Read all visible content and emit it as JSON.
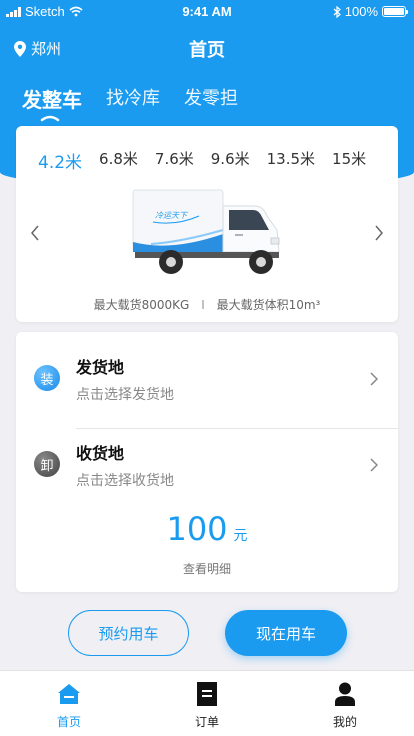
{
  "status_bar": {
    "carrier": "Sketch",
    "time": "9:41 AM",
    "battery": "100%"
  },
  "header": {
    "location": "郑州",
    "title": "首页"
  },
  "tabs": [
    {
      "label": "发整车",
      "active": true
    },
    {
      "label": "找冷库",
      "active": false
    },
    {
      "label": "发零担",
      "active": false
    }
  ],
  "truck_sizes": [
    {
      "label": "4.2米",
      "active": true
    },
    {
      "label": "6.8米",
      "active": false
    },
    {
      "label": "7.6米",
      "active": false
    },
    {
      "label": "9.6米",
      "active": false
    },
    {
      "label": "13.5米",
      "active": false
    },
    {
      "label": "15米",
      "active": false
    }
  ],
  "truck": {
    "brand_text": "冷运天下",
    "max_load": "最大载货8000KG",
    "separator": "I",
    "max_volume": "最大载货体积10m³"
  },
  "route": {
    "origin": {
      "badge": "装",
      "title": "发货地",
      "hint": "点击选择发货地"
    },
    "destination": {
      "badge": "卸",
      "title": "收货地",
      "hint": "点击选择收货地"
    }
  },
  "price": {
    "amount": "100",
    "unit": "元",
    "detail_label": "查看明细"
  },
  "actions": {
    "reserve_label": "预约用车",
    "now_label": "现在用车"
  },
  "tabbar": [
    {
      "label": "首页",
      "icon": "home-icon",
      "active": true
    },
    {
      "label": "订单",
      "icon": "order-icon",
      "active": false
    },
    {
      "label": "我的",
      "icon": "profile-icon",
      "active": false
    }
  ],
  "colors": {
    "accent": "#1a9bf0",
    "background": "#efeff4"
  }
}
